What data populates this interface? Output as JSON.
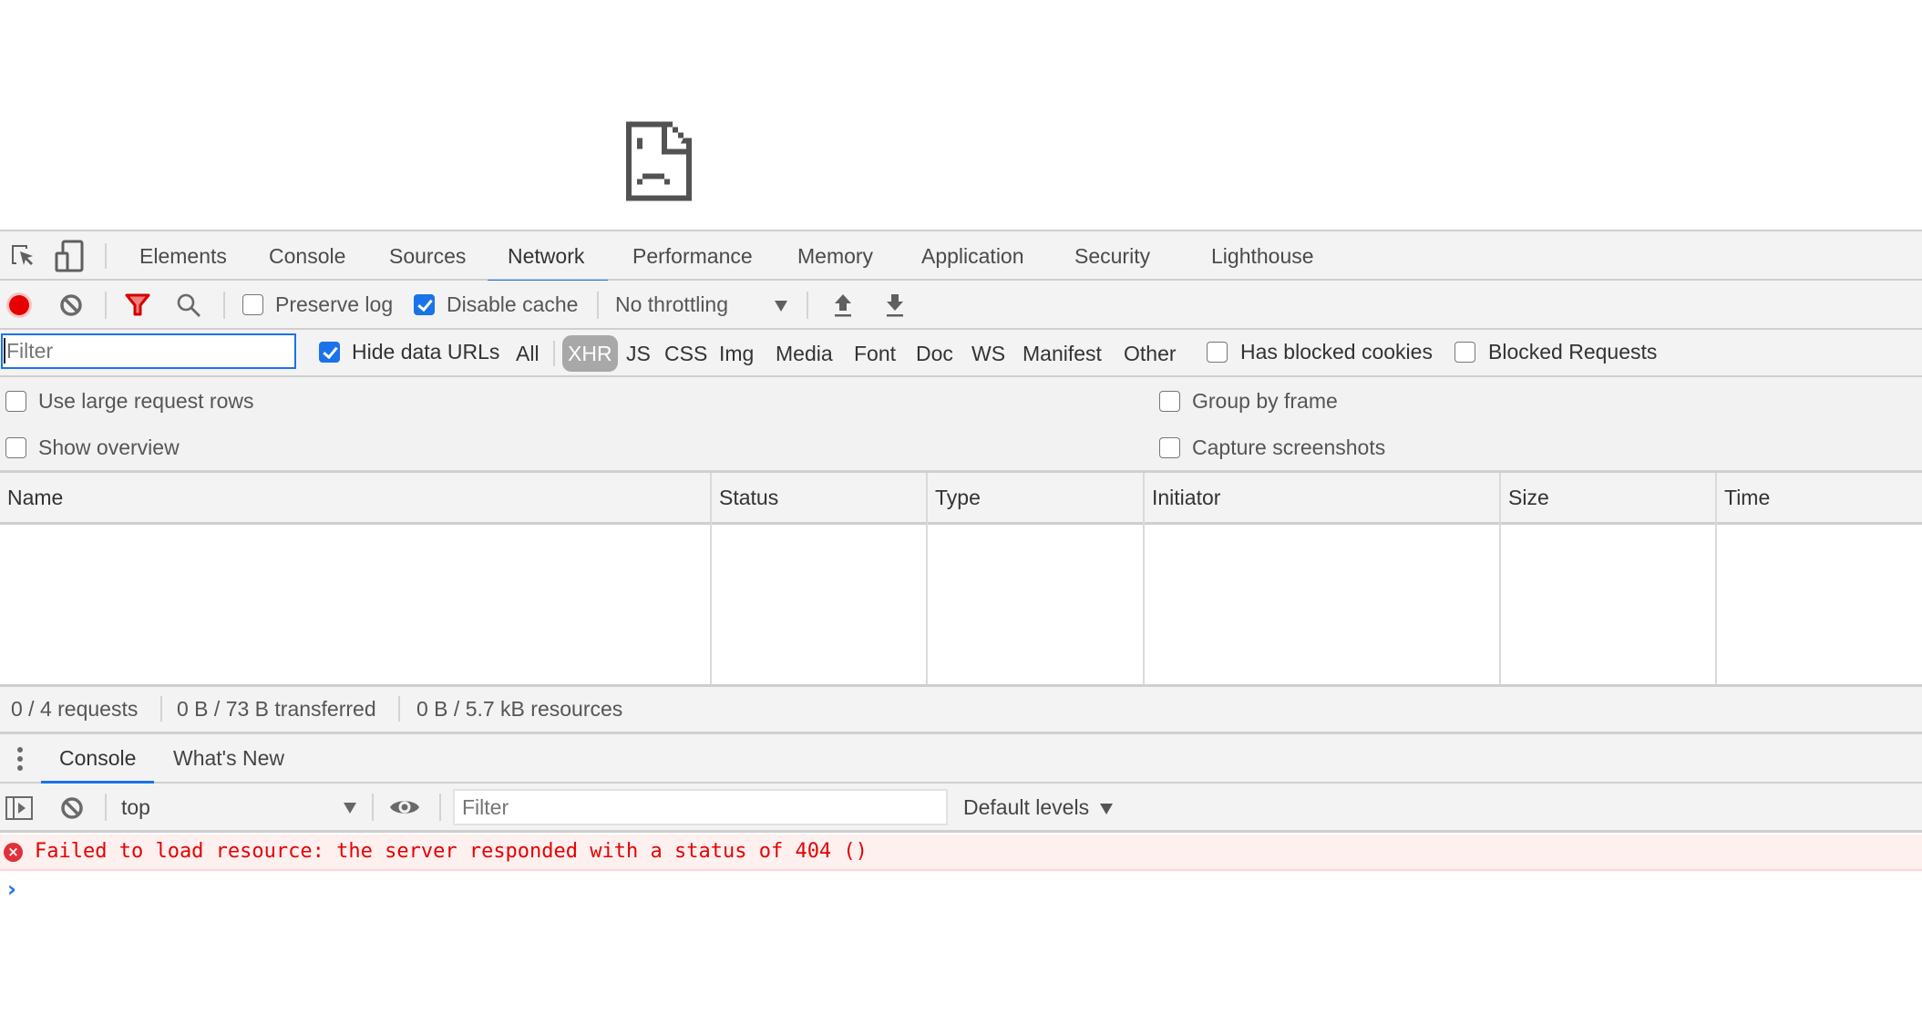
{
  "page": {
    "error_icon": "sad-page-icon"
  },
  "devtools": {
    "tabs": [
      {
        "label": "Elements",
        "active": false
      },
      {
        "label": "Console",
        "active": false
      },
      {
        "label": "Sources",
        "active": false
      },
      {
        "label": "Network",
        "active": true
      },
      {
        "label": "Performance",
        "active": false
      },
      {
        "label": "Memory",
        "active": false
      },
      {
        "label": "Application",
        "active": false
      },
      {
        "label": "Security",
        "active": false
      },
      {
        "label": "Lighthouse",
        "active": false
      }
    ],
    "left_icons": [
      "inspect-element-icon",
      "device-toolbar-icon"
    ]
  },
  "network": {
    "toolbar": {
      "record": {
        "icon": "record-icon",
        "active": true,
        "color": "#e60000"
      },
      "clear": {
        "icon": "clear-icon"
      },
      "filter": {
        "icon": "filter-icon",
        "color": "#d50000"
      },
      "search": {
        "icon": "search-icon"
      },
      "preserve_log": {
        "label": "Preserve log",
        "checked": false
      },
      "disable_cache": {
        "label": "Disable cache",
        "checked": true
      },
      "throttling": {
        "value": "No throttling"
      },
      "import": {
        "icon": "upload-icon"
      },
      "export": {
        "icon": "download-icon"
      }
    },
    "filter_bar": {
      "filter_placeholder": "Filter",
      "filter_value": "",
      "hide_data_urls": {
        "label": "Hide data URLs",
        "checked": true
      },
      "all_label": "All",
      "types": [
        {
          "label": "XHR",
          "active": true
        },
        {
          "label": "JS",
          "active": false
        },
        {
          "label": "CSS",
          "active": false
        },
        {
          "label": "Img",
          "active": false
        },
        {
          "label": "Media",
          "active": false
        },
        {
          "label": "Font",
          "active": false
        },
        {
          "label": "Doc",
          "active": false
        },
        {
          "label": "WS",
          "active": false
        },
        {
          "label": "Manifest",
          "active": false
        },
        {
          "label": "Other",
          "active": false
        }
      ],
      "has_blocked_cookies": {
        "label": "Has blocked cookies",
        "checked": false
      },
      "blocked_requests": {
        "label": "Blocked Requests",
        "checked": false
      }
    },
    "settings": {
      "use_large_rows": {
        "label": "Use large request rows",
        "checked": false
      },
      "show_overview": {
        "label": "Show overview",
        "checked": false
      },
      "group_by_frame": {
        "label": "Group by frame",
        "checked": false
      },
      "capture_screenshots": {
        "label": "Capture screenshots",
        "checked": false
      }
    },
    "table": {
      "columns": [
        "Name",
        "Status",
        "Type",
        "Initiator",
        "Size",
        "Time"
      ],
      "rows": []
    },
    "status_bar": {
      "requests": "0 / 4 requests",
      "transferred": "0 B / 73 B transferred",
      "resources": "0 B / 5.7 kB resources"
    }
  },
  "drawer": {
    "menu_icon": "more-vertical-icon",
    "tabs": [
      {
        "label": "Console",
        "active": true
      },
      {
        "label": "What's New",
        "active": false
      }
    ],
    "console_toolbar": {
      "sidebar_icon": "show-sidebar-icon",
      "clear_icon": "clear-console-icon",
      "context": "top",
      "live_expression_icon": "eye-icon",
      "filter_placeholder": "Filter",
      "levels": "Default levels"
    },
    "messages": [
      {
        "level": "error",
        "text": "Failed to load resource: the server responded with a status of 404 ()"
      }
    ],
    "prompt_symbol": "›"
  },
  "colors": {
    "accent": "#1a73e8",
    "record": "#e60000",
    "error_text": "#e60000",
    "error_bg": "#fff0f0",
    "toolbar_bg": "#f3f3f3"
  }
}
